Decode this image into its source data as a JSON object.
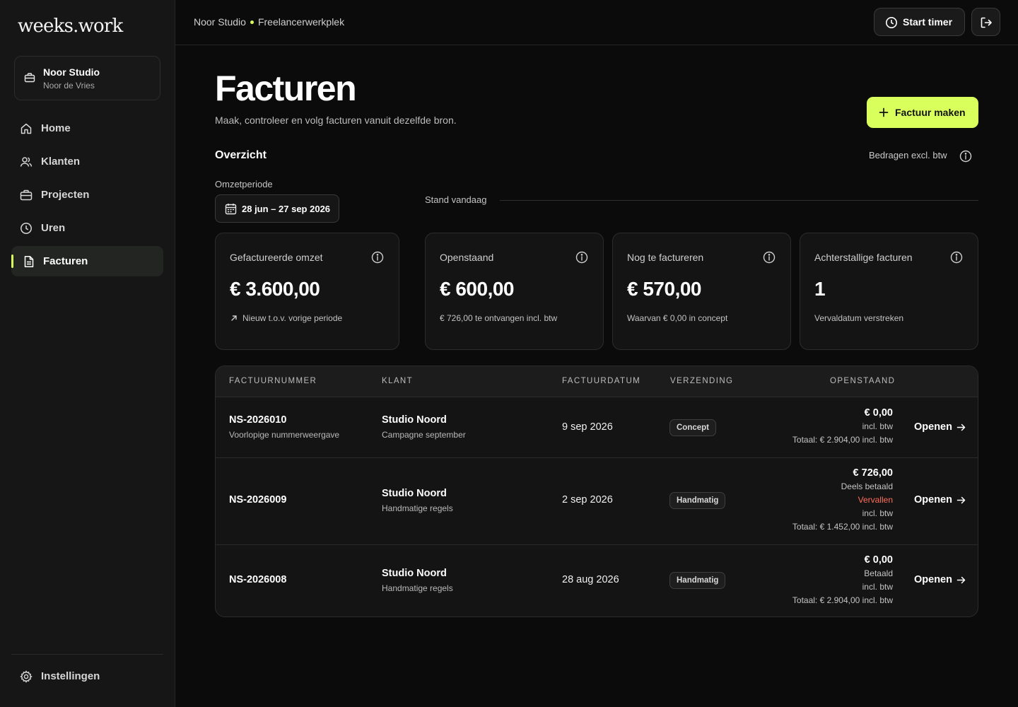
{
  "app": {
    "logo": "weeks.work"
  },
  "workspace": {
    "name": "Noor Studio",
    "user": "Noor de Vries"
  },
  "nav": {
    "home": "Home",
    "clients": "Klanten",
    "projects": "Projecten",
    "hours": "Uren",
    "invoices": "Facturen",
    "settings": "Instellingen"
  },
  "topbar": {
    "crumb_studio": "Noor Studio",
    "crumb_workspace": "Freelancerwerkplek",
    "timer_label": "Start timer"
  },
  "page": {
    "title": "Facturen",
    "subtitle": "Maak, controleer en volg facturen vanuit dezelfde bron.",
    "create_label": "Factuur maken"
  },
  "overview": {
    "title": "Overzicht",
    "amount_note": "Bedragen excl. btw",
    "period_label": "Omzetperiode",
    "period_value": "28 jun – 27 sep 2026",
    "stand_label": "Stand vandaag"
  },
  "kpis": [
    {
      "label": "Gefactureerde omzet",
      "value": "€ 3.600,00",
      "sub": "Nieuw t.o.v. vorige periode"
    },
    {
      "label": "Openstaand",
      "value": "€ 600,00",
      "sub": "€ 726,00 te ontvangen incl. btw"
    },
    {
      "label": "Nog te factureren",
      "value": "€ 570,00",
      "sub": "Waarvan € 0,00 in concept"
    },
    {
      "label": "Achterstallige facturen",
      "value": "1",
      "sub": "Vervaldatum verstreken"
    }
  ],
  "table": {
    "headers": [
      "FACTUURNUMMER",
      "KLANT",
      "FACTUURDATUM",
      "VERZENDING",
      "OPENSTAAND"
    ],
    "rows": [
      {
        "number": "NS-2026010",
        "number_sub": "Voorlopige nummerweergave",
        "client": "Studio Noord",
        "client_sub": "Campagne september",
        "date": "9 sep 2026",
        "dispatch": "Concept",
        "amount": "€ 0,00",
        "line1": "incl. btw",
        "total": "Totaal: € 2.904,00 incl. btw",
        "open_label": "Openen"
      },
      {
        "number": "NS-2026009",
        "client": "Studio Noord",
        "client_sub": "Handmatige regels",
        "date": "2 sep 2026",
        "dispatch": "Handmatig",
        "amount": "€ 726,00",
        "line1": "Deels betaald",
        "line2": "Vervallen",
        "line3": "incl. btw",
        "total": "Totaal: € 1.452,00 incl. btw",
        "open_label": "Openen"
      },
      {
        "number": "NS-2026008",
        "client": "Studio Noord",
        "client_sub": "Handmatige regels",
        "date": "28 aug 2026",
        "dispatch": "Handmatig",
        "amount": "€ 0,00",
        "line1": "Betaald",
        "line2": "incl. btw",
        "total": "Totaal: € 2.904,00 incl. btw",
        "open_label": "Openen"
      }
    ]
  },
  "colors": {
    "accent": "#d8ff5b",
    "danger": "#ff6e5c",
    "background": "#0b0b0b",
    "sidebar": "#161616"
  }
}
